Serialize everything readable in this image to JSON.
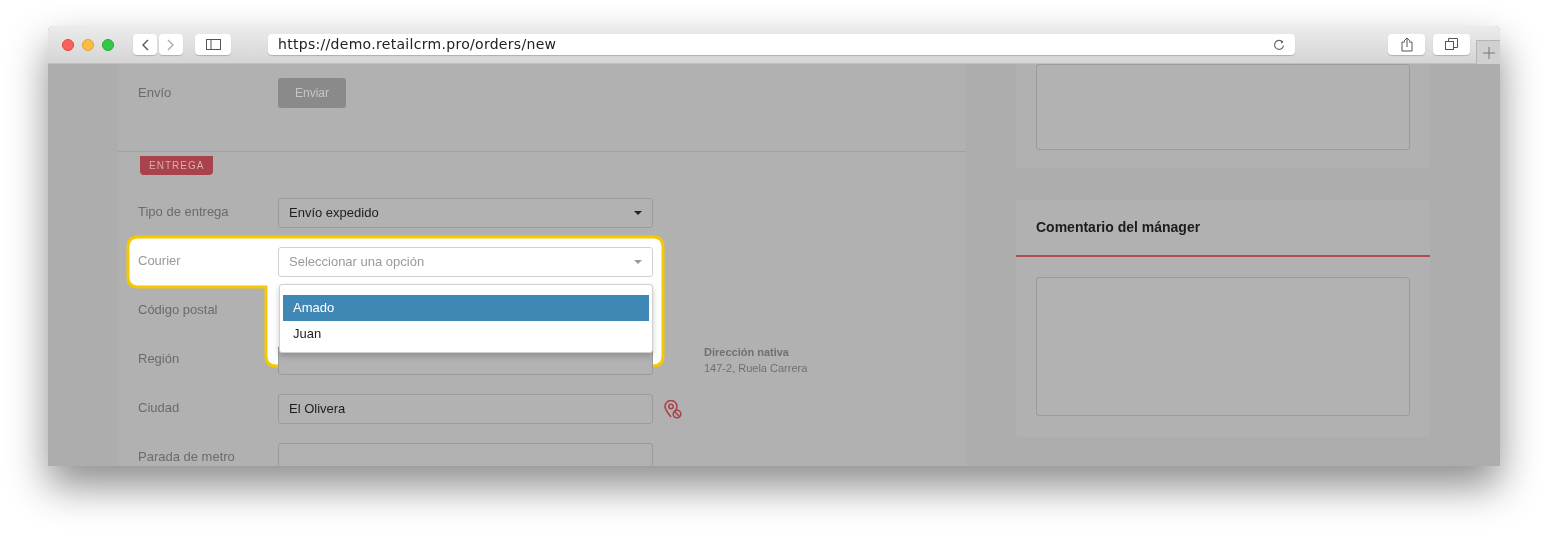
{
  "browser": {
    "url": "https://demo.retailcrm.pro/orders/new"
  },
  "form": {
    "send_row": {
      "label": "Envío",
      "button": {
        "label": "Enviar",
        "disabled": true
      }
    },
    "section_tag": "ENTREGA",
    "fields": [
      {
        "label": "Tipo de entrega",
        "kind": "select",
        "value": "Envío expedido"
      },
      {
        "label": "Courier",
        "kind": "select",
        "placeholder": "Seleccionar una opción",
        "highlighted": true,
        "expanded": true,
        "options": [
          {
            "label": "Amado",
            "selected": true
          },
          {
            "label": "Juan",
            "selected": false
          }
        ]
      },
      {
        "label": "Código postal",
        "kind": "text",
        "covered": true
      },
      {
        "label": "Región",
        "kind": "text",
        "note_title": "Dirección nativa",
        "note_text": "147-2, Ruela Carrera"
      },
      {
        "label": "Ciudad",
        "kind": "text",
        "value": "El Olivera",
        "map_pin": true
      },
      {
        "label": "Parada de metro",
        "kind": "text"
      }
    ]
  },
  "sidebar": {
    "cards": [
      {
        "kind": "textarea"
      },
      {
        "kind": "comment",
        "title": "Comentario del mánager"
      }
    ]
  }
}
